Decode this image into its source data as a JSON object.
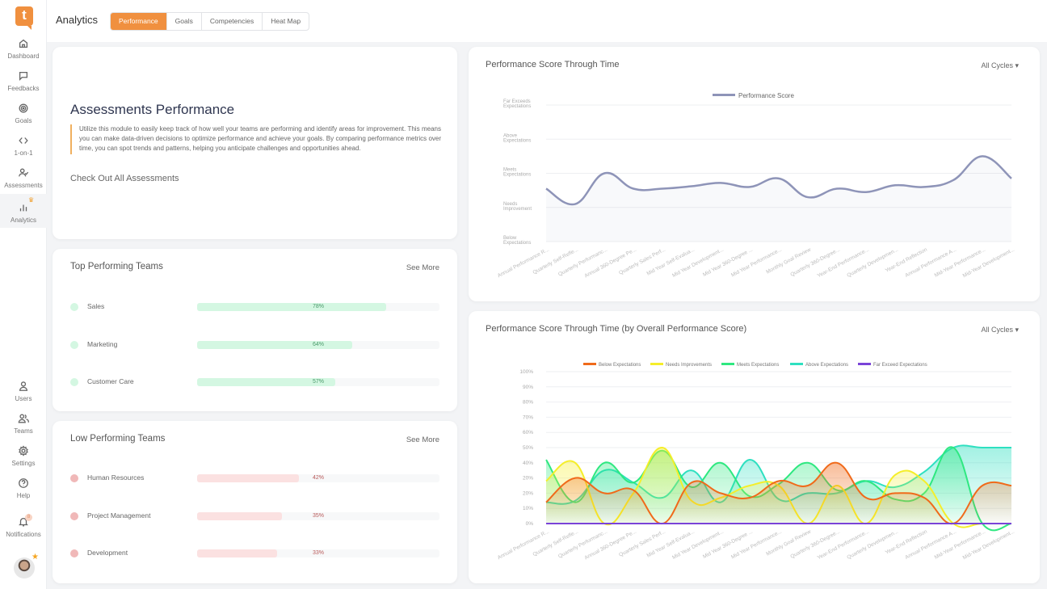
{
  "app": {
    "logo_letter": "t",
    "page_title": "Analytics"
  },
  "tabs": [
    {
      "label": "Performance",
      "active": true
    },
    {
      "label": "Goals",
      "active": false
    },
    {
      "label": "Competencies",
      "active": false
    },
    {
      "label": "Heat Map",
      "active": false
    }
  ],
  "sidebar": {
    "items": [
      {
        "label": "Dashboard",
        "icon": "home-icon"
      },
      {
        "label": "Feedbacks",
        "icon": "chat-bubble-icon"
      },
      {
        "label": "Goals",
        "icon": "target-icon"
      },
      {
        "label": "1-on-1",
        "icon": "code-brackets-icon"
      },
      {
        "label": "Assessments",
        "icon": "user-check-icon"
      },
      {
        "label": "Analytics",
        "icon": "bar-chart-icon",
        "active": true
      }
    ],
    "bottom_items": [
      {
        "label": "Users",
        "icon": "user-icon"
      },
      {
        "label": "Teams",
        "icon": "users-icon"
      },
      {
        "label": "Settings",
        "icon": "gear-icon"
      },
      {
        "label": "Help",
        "icon": "help-circle-icon"
      }
    ],
    "notifications": {
      "label": "Notifications",
      "badge": "8"
    }
  },
  "assessments": {
    "title": "Assessments Performance",
    "description": "Utilize this module to easily keep track of how well your teams are performing and identify areas for improvement. This means you can make data-driven decisions to optimize performance and achieve your goals. By comparing performance metrics over time, you can spot trends and patterns, helping you anticipate challenges and opportunities ahead.",
    "link": "Check Out All Assessments"
  },
  "top_teams": {
    "title": "Top Performing Teams",
    "see_more": "See More",
    "color": "#d4f7e2",
    "text_color": "#4a9a6a",
    "teams": [
      {
        "name": "Sales",
        "percent": 78,
        "label": "78%"
      },
      {
        "name": "Marketing",
        "percent": 64,
        "label": "64%"
      },
      {
        "name": "Customer Care",
        "percent": 57,
        "label": "57%"
      }
    ]
  },
  "low_teams": {
    "title": "Low Performing Teams",
    "see_more": "See More",
    "color": "#fbe1e1",
    "dot_color": "#f0b8b8",
    "text_color": "#b85a5a",
    "teams": [
      {
        "name": "Human Resources",
        "percent": 42,
        "label": "42%"
      },
      {
        "name": "Project Management",
        "percent": 35,
        "label": "35%"
      },
      {
        "name": "Development",
        "percent": 33,
        "label": "33%"
      }
    ]
  },
  "chart_data": [
    {
      "type": "line",
      "title": "Performance Score Through Time",
      "filter": "All Cycles",
      "legend": [
        "Performance Score"
      ],
      "legend_position": "top",
      "y_ticks": [
        "Below Expectations",
        "Needs Improvement",
        "Meets Expectations",
        "Above Expectations",
        "Far Exceeds Expectations"
      ],
      "ylim": [
        0,
        4
      ],
      "grid": true,
      "categories": [
        "Annual Performance R...",
        "Quarterly Self-Refle...",
        "Quarterly Performanc...",
        "Annual 360-Degree Pe...",
        "Quarterly Sales Perf...",
        "Mid Year Self-Evalua...",
        "Mid Year Development...",
        "Mid Year 360-Degree ...",
        "Mid Year Performance...",
        "Monthly Goal Review",
        "Quarterly 360-Degree...",
        "Year-End Performance...",
        "Quarterly Developmen...",
        "Year-End Reflection",
        "Annual Performance A...",
        "Mid-Year Performance...",
        "Mid-Year Development..."
      ],
      "series": [
        {
          "name": "Performance Score",
          "color": "#8e94b8",
          "values": [
            1.55,
            1.1,
            2.0,
            1.55,
            1.55,
            1.62,
            1.72,
            1.6,
            1.85,
            1.3,
            1.55,
            1.45,
            1.65,
            1.6,
            1.8,
            2.5,
            1.85
          ]
        }
      ]
    },
    {
      "type": "area",
      "title": "Performance Score Through Time (by Overall Performance Score)",
      "filter": "All Cycles",
      "legend_position": "top",
      "ylim": [
        0,
        100
      ],
      "y_ticks": [
        "0%",
        "10%",
        "20%",
        "20%",
        "40%",
        "50%",
        "60%",
        "70%",
        "80%",
        "90%",
        "100%"
      ],
      "grid": true,
      "categories": [
        "Annual Performance R...",
        "Quarterly Self-Refle...",
        "Quarterly Performanc...",
        "Annual 360-Degree Pe...",
        "Quarterly Sales Perf...",
        "Mid Year Self-Evalua...",
        "Mid Year Development...",
        "Mid Year 360-Degree ...",
        "Mid Year Performance...",
        "Monthly Goal Review",
        "Quarterly 360-Degree...",
        "Year-End Performance...",
        "Quarterly Developmen...",
        "Year-End Reflection",
        "Annual Performance A...",
        "Mid-Year Performance...",
        "Mid-Year Development..."
      ],
      "series": [
        {
          "name": "Below Expectations",
          "color": "#f06a1a",
          "values": [
            14,
            30,
            20,
            22,
            0,
            27,
            20,
            17,
            28,
            25,
            40,
            17,
            20,
            17,
            0,
            25,
            25
          ]
        },
        {
          "name": "Needs Improvements",
          "color": "#f5ee2a",
          "values": [
            28,
            40,
            0,
            20,
            50,
            15,
            17,
            25,
            25,
            0,
            25,
            0,
            32,
            28,
            0,
            0,
            0
          ]
        },
        {
          "name": "Meets Expectations",
          "color": "#2ee880",
          "values": [
            42,
            14,
            40,
            27,
            48,
            24,
            40,
            18,
            26,
            40,
            22,
            28,
            16,
            20,
            50,
            0,
            0
          ]
        },
        {
          "name": "Above Expectations",
          "color": "#2ee0c0",
          "values": [
            14,
            15,
            35,
            27,
            17,
            35,
            14,
            42,
            16,
            20,
            20,
            28,
            24,
            34,
            50,
            50,
            50
          ]
        },
        {
          "name": "Far Exceed Expectations",
          "color": "#7a44d8",
          "values": [
            0,
            0,
            0,
            0,
            0,
            0,
            0,
            0,
            0,
            0,
            0,
            0,
            0,
            0,
            0,
            0,
            0
          ]
        }
      ]
    }
  ]
}
